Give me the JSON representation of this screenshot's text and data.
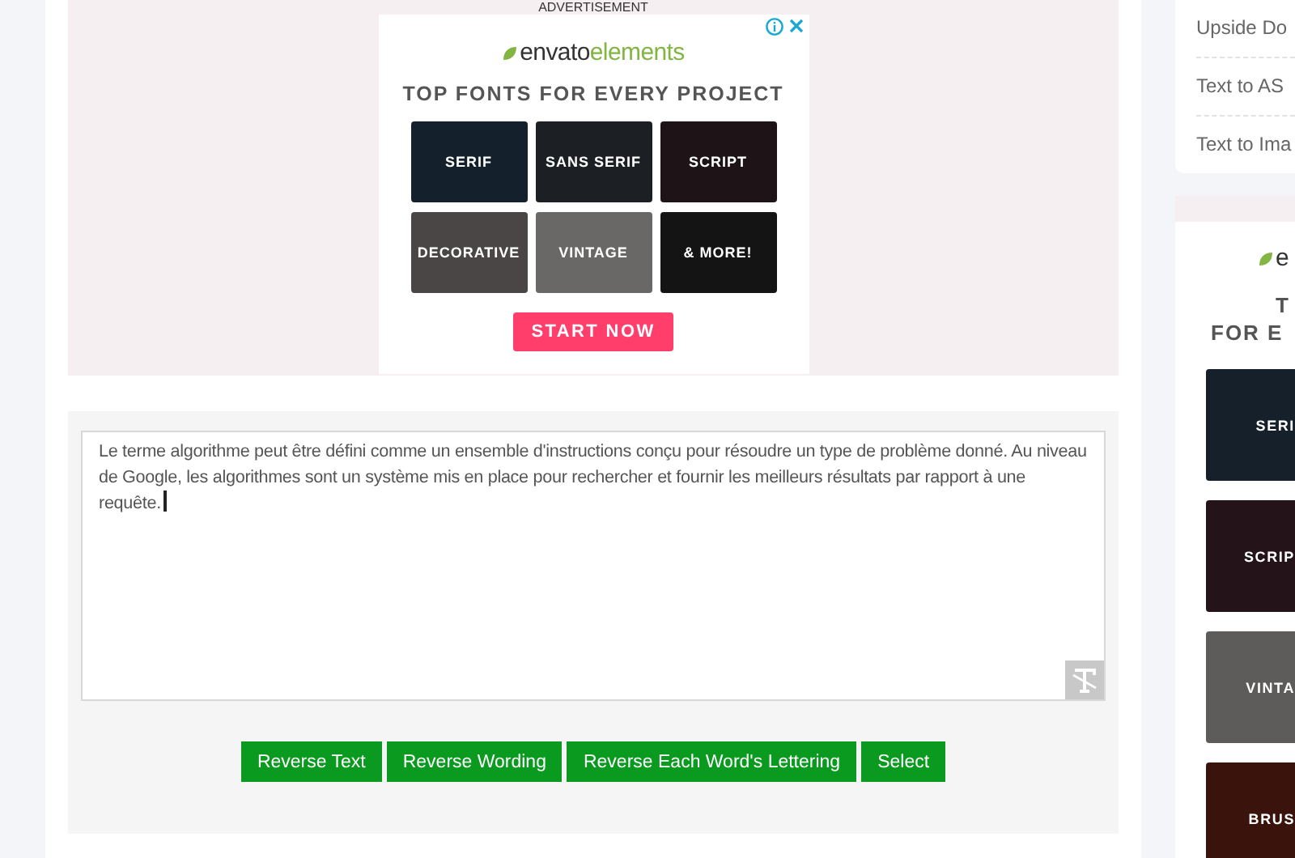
{
  "main_ad": {
    "label": "ADVERTISEMENT",
    "logo": {
      "brand": "envato",
      "suffix": "elements"
    },
    "headline": "TOP FONTS FOR EVERY PROJECT",
    "tiles": [
      {
        "label": "SERIF",
        "color": "#14202c"
      },
      {
        "label": "SANS SERIF",
        "color": "#1c1f24"
      },
      {
        "label": "SCRIPT",
        "color": "#1e1418"
      },
      {
        "label": "DECORATIVE",
        "color": "#4a4646"
      },
      {
        "label": "VINTAGE",
        "color": "#6a6866"
      },
      {
        "label": "& MORE!",
        "color": "#141414"
      }
    ],
    "cta": "START NOW"
  },
  "tool": {
    "text": "Le terme algorithme peut être défini comme un ensemble d'instructions conçu pour résoudre un type de problème donné. Au niveau de Google, les algorithmes sont un système mis en place pour rechercher et fournir les meilleurs résultats par rapport à une requête.",
    "buttons": [
      "Reverse Text",
      "Reverse Wording",
      "Reverse Each Word's Lettering",
      "Select"
    ]
  },
  "sidebar": {
    "links": [
      "Upside Do",
      "Text to AS",
      "Text to Ima"
    ]
  },
  "side_ad": {
    "logo_fragment": "e",
    "headline_lines": [
      "T",
      "FOR E"
    ],
    "tiles": [
      {
        "label": "SERI",
        "color": "#15202a"
      },
      {
        "label": "SCRIP",
        "color": "#24141a"
      },
      {
        "label": "VINTA",
        "color": "#5e5c5a"
      },
      {
        "label": "BRUS",
        "color": "#3a140c"
      }
    ]
  }
}
